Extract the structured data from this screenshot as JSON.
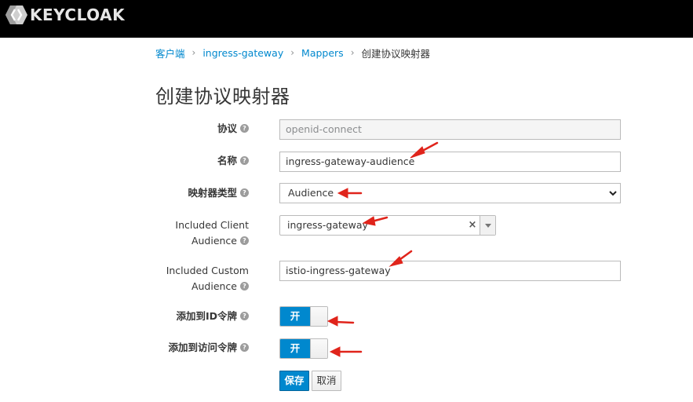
{
  "header": {
    "logo_text": "KEYCLOAK",
    "background": "#000000"
  },
  "breadcrumb": {
    "items": [
      "客户端",
      "ingress-gateway",
      "Mappers"
    ],
    "separator": "›",
    "current": "创建协议映射器"
  },
  "page": {
    "title": "创建协议映射器"
  },
  "form": {
    "protocol": {
      "label": "协议",
      "value": "openid-connect"
    },
    "name": {
      "label": "名称",
      "value": "ingress-gateway-audience"
    },
    "mapper_type": {
      "label": "映射器类型",
      "value": "Audience"
    },
    "included_client_audience": {
      "label_line1": "Included Client",
      "label_line2": "Audience",
      "value": "ingress-gateway",
      "clear_glyph": "×"
    },
    "included_custom_audience": {
      "label_line1": "Included Custom",
      "label_line2": "Audience",
      "value": "istio-ingress-gateway"
    },
    "add_to_id_token": {
      "label": "添加到ID令牌",
      "state_label": "开",
      "on": true
    },
    "add_to_access_token": {
      "label": "添加到访问令牌",
      "state_label": "开",
      "on": true
    },
    "help_glyph": "?"
  },
  "actions": {
    "save_label": "保存",
    "cancel_label": "取消"
  },
  "colors": {
    "accent": "#0088ce",
    "annotation_arrow": "#e0241b"
  }
}
